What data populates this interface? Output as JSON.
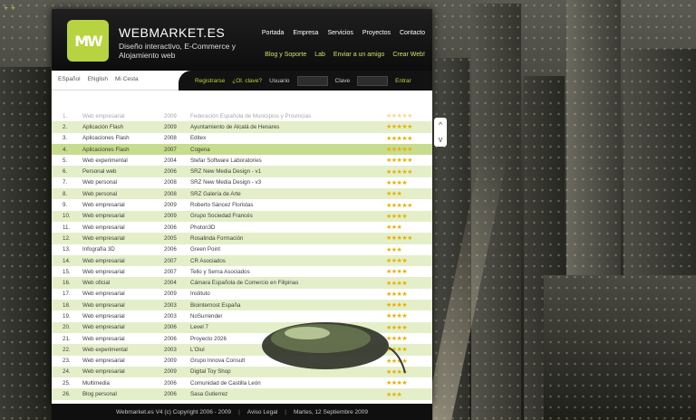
{
  "site": {
    "logo_text": "MW",
    "name": "WEBMARKET.ES",
    "tagline": "Diseño interactivo, E-Commerce y Alojamiento web"
  },
  "nav": {
    "main": [
      "Portada",
      "Empresa",
      "Servicios",
      "Proyectos",
      "Contacto"
    ],
    "sub": [
      "Blog y Soporte",
      "Lab",
      "Enviar a un amigo",
      "Crear Web!"
    ]
  },
  "lang": [
    "ESpañol",
    "ENglish",
    "Mi Cesta"
  ],
  "login": {
    "register": "Registrarse",
    "forgot": "¿Ol. clave?",
    "user_label": "Usuario",
    "pass_label": "Clave",
    "enter": "Entrar"
  },
  "corner_mark": "+ +",
  "scroll": {
    "up": "^",
    "down": "v"
  },
  "projects": [
    {
      "n": "1.",
      "cat": "Web empresarial",
      "year": "2009",
      "client": "Federación Española de Municipios y Provincias",
      "stars": "★★★★★"
    },
    {
      "n": "2.",
      "cat": "Aplicación Flash",
      "year": "2009",
      "client": "Ayuntamiento de Alcalá de Henares",
      "stars": "★★★★★"
    },
    {
      "n": "3.",
      "cat": "Aplicaciones Flash",
      "year": "2008",
      "client": "Editex",
      "stars": "★★★★★"
    },
    {
      "n": "4.",
      "cat": "Aplicaciones Flash",
      "year": "2007",
      "client": "Cogena",
      "stars": "★★★★★"
    },
    {
      "n": "5.",
      "cat": "Web experimental",
      "year": "2004",
      "client": "Stefar Software Laboratories",
      "stars": "★★★★★"
    },
    {
      "n": "6.",
      "cat": "Personal web",
      "year": "2006",
      "client": "SRZ New Media Design - v1",
      "stars": "★★★★★"
    },
    {
      "n": "7.",
      "cat": "Web personal",
      "year": "2008",
      "client": "SRZ New Media Design - v3",
      "stars": "★★★★"
    },
    {
      "n": "8.",
      "cat": "Web personal",
      "year": "2008",
      "client": "SRZ Galería de Arte",
      "stars": "★★★"
    },
    {
      "n": "9.",
      "cat": "Web empresarial",
      "year": "2009",
      "client": "Roberto Sáncez Floristas",
      "stars": "★★★★★"
    },
    {
      "n": "10.",
      "cat": "Web empresarial",
      "year": "2009",
      "client": "Grupo Sociedad Francés",
      "stars": "★★★★"
    },
    {
      "n": "11.",
      "cat": "Web empresarial",
      "year": "2006",
      "client": "Photon3D",
      "stars": "★★★"
    },
    {
      "n": "12.",
      "cat": "Web empresarial",
      "year": "2005",
      "client": "Rosalinda Formación",
      "stars": "★★★★★"
    },
    {
      "n": "13.",
      "cat": "Infografía 3D",
      "year": "2006",
      "client": "Green Point",
      "stars": "★★★"
    },
    {
      "n": "14.",
      "cat": "Web empresarial",
      "year": "2007",
      "client": "CR Asociados",
      "stars": "★★★★"
    },
    {
      "n": "15.",
      "cat": "Web empresarial",
      "year": "2007",
      "client": "Tello y Serna Asociados",
      "stars": "★★★★"
    },
    {
      "n": "16.",
      "cat": "Web oficial",
      "year": "2004",
      "client": "Cámara Española de Comercio en Filipinas",
      "stars": "★★★★"
    },
    {
      "n": "17.",
      "cat": "Web empresarial",
      "year": "2009",
      "client": "Instituto",
      "stars": "★★★★"
    },
    {
      "n": "18.",
      "cat": "Web empresarial",
      "year": "2003",
      "client": "Biointernost España",
      "stars": "★★★★"
    },
    {
      "n": "19.",
      "cat": "Web empresarial",
      "year": "2003",
      "client": "NoSurrender",
      "stars": "★★★★"
    },
    {
      "n": "20.",
      "cat": "Web empresarial",
      "year": "2006",
      "client": "Level 7",
      "stars": "★★★★"
    },
    {
      "n": "21.",
      "cat": "Web empresarial",
      "year": "2006",
      "client": "Proyecto 2026",
      "stars": "★★★★"
    },
    {
      "n": "22.",
      "cat": "Web experimental",
      "year": "2003",
      "client": "L'Oiul",
      "stars": "★★★★"
    },
    {
      "n": "23.",
      "cat": "Web empresarial",
      "year": "2009",
      "client": "Grupo Innova Consult",
      "stars": "★★★★"
    },
    {
      "n": "24.",
      "cat": "Web empresarial",
      "year": "2009",
      "client": "Digital Toy Shop",
      "stars": "★★★★"
    },
    {
      "n": "25.",
      "cat": "Multimedia",
      "year": "2006",
      "client": "Comunidad de Castilla León",
      "stars": "★★★★"
    },
    {
      "n": "26.",
      "cat": "Blog personal",
      "year": "2006",
      "client": "Sasa Gutierrez",
      "stars": "★★★"
    }
  ],
  "footer": {
    "copyright": "Webmarket.es V4 (c) Copyright 2006 - 2009",
    "sep": "|",
    "legal": "Aviso Legal",
    "date": "Martes, 12 Septiembre 2009"
  },
  "colors": {
    "accent": "#b7d33f",
    "row_alt": "#e4efc9",
    "highlight": "#c7dc8e",
    "stars": "#e8b000"
  }
}
